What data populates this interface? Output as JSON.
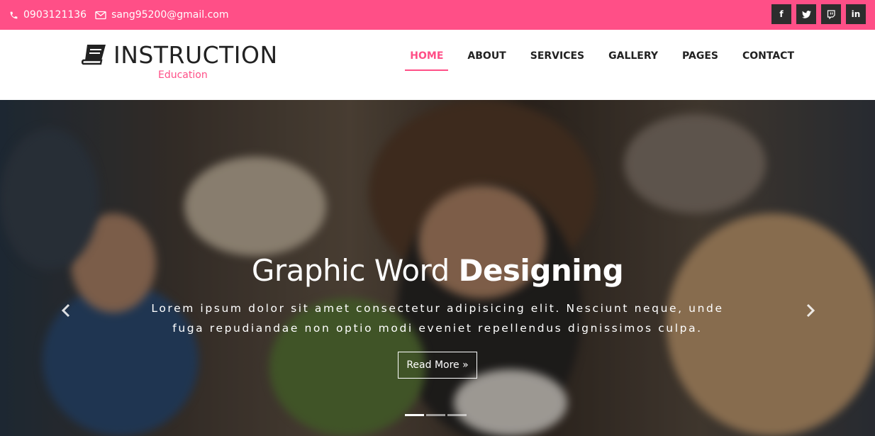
{
  "topbar": {
    "phone": "0903121136",
    "email": "sang95200@gmail.com",
    "social": [
      {
        "icon": "facebook-icon",
        "glyph": "f"
      },
      {
        "icon": "twitter-icon",
        "glyph": "t"
      },
      {
        "icon": "twitch-icon",
        "glyph": ""
      },
      {
        "icon": "linkedin-icon",
        "glyph": "in"
      }
    ]
  },
  "header": {
    "brand": "INSTRUCTION",
    "tagline": "Education",
    "nav": [
      "HOME",
      "ABOUT",
      "SERVICES",
      "GALLERY",
      "PAGES",
      "CONTACT"
    ],
    "active_nav": "HOME"
  },
  "hero": {
    "title_light": "Graphic Word ",
    "title_bold": "Designing",
    "text_line1": "Lorem ipsum dolor sit amet consectetur adipisicing elit. Nesciunt neque, unde",
    "text_line2": "fuga repudiandae non optio modi eveniet repellendus dignissimos culpa.",
    "button_label": "Read More »",
    "slides": 3,
    "active_slide": 1
  },
  "colors": {
    "accent": "#ff4f87",
    "dark": "#2d2d2d"
  }
}
